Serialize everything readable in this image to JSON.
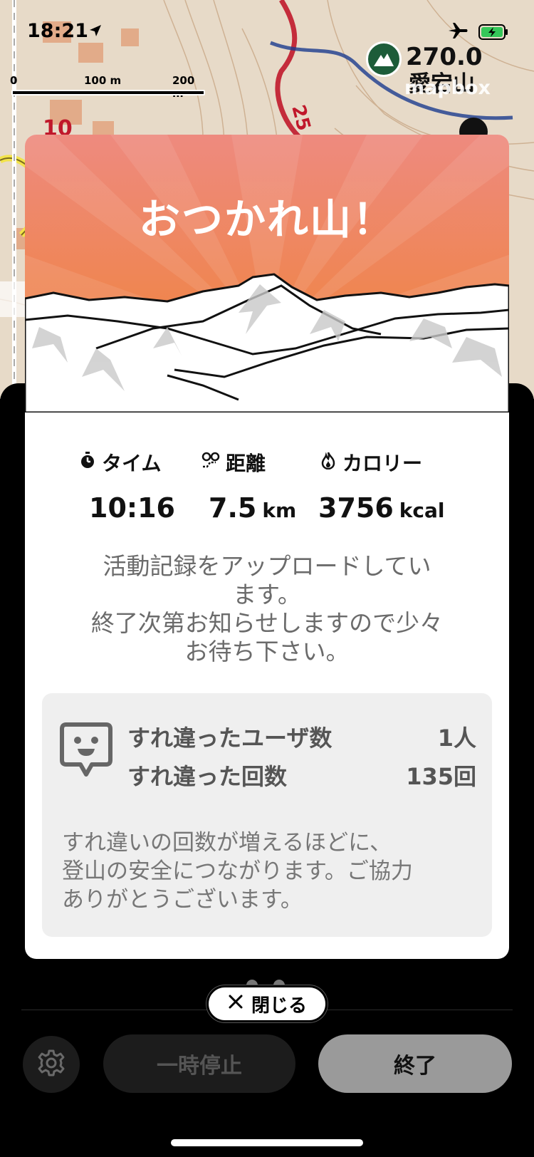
{
  "status_bar": {
    "time": "18:21"
  },
  "map": {
    "scale_labels": [
      "0",
      "100 m",
      "200 m"
    ],
    "peak_elevation": "270.0",
    "peak_name": "愛宕山",
    "attribution": "mapbox",
    "route_marker": "25",
    "road_marker": "10"
  },
  "modal": {
    "title": "おつかれ山！",
    "stats": {
      "time": {
        "label": "タイム",
        "value": "10:16",
        "unit": ""
      },
      "distance": {
        "label": "距離",
        "value": "7.5",
        "unit": "km"
      },
      "calories": {
        "label": "カロリー",
        "value": "3756",
        "unit": "kcal"
      }
    },
    "upload_message": [
      "活動記録をアップロードしてい",
      "ます。",
      "終了次第お知らせしますので少々",
      "お待ち下さい。"
    ],
    "passing": {
      "users_label": "すれ違ったユーザ数",
      "users_value": "1人",
      "count_label": "すれ違った回数",
      "count_value": "135回",
      "note": [
        "すれ違いの回数が増えるほどに、",
        "登山の安全につながります。ご協力",
        "ありがとうございます。"
      ]
    }
  },
  "controls": {
    "close_label": "閉じる",
    "pause_label": "一時停止",
    "end_label": "終了"
  },
  "colors": {
    "header_top": "#ee8a7f",
    "header_bottom": "#f07f2e",
    "route_red": "#c0182b",
    "peak_green": "#1d5c39"
  }
}
